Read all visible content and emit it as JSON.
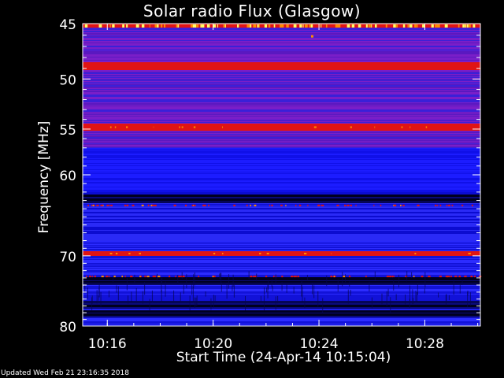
{
  "chart_data": {
    "type": "heatmap",
    "title": "Solar radio Flux (Glasgow)",
    "xlabel": "Start Time (24-Apr-14 10:15:04)",
    "ylabel": "Frequency [MHz]",
    "x_tick_labels": [
      "10:16",
      "10:20",
      "10:24",
      "10:28"
    ],
    "x_tick_minutes": [
      16,
      20,
      24,
      28
    ],
    "xlim_minutes": [
      15.07,
      30.1
    ],
    "y_tick_labels": [
      "45",
      "50",
      "55",
      "60",
      "70",
      "80"
    ],
    "y_tick_values": [
      45,
      50,
      55,
      60,
      70,
      80
    ],
    "ylim": [
      45,
      80
    ],
    "y_scale": "log",
    "color_scale": [
      "#00001e",
      "#0000c8",
      "#2424ff",
      "#7a1ec8",
      "#e01414",
      "#ff8c00",
      "#ffff64"
    ],
    "bright_bands_mhz": [
      45.0,
      48.8,
      54.8,
      69.7
    ],
    "dark_bands_mhz": [
      62.8,
      73.5,
      76.8,
      78.2
    ]
  },
  "footer_text": "Updated Wed Feb 21 23:16:35 2018"
}
